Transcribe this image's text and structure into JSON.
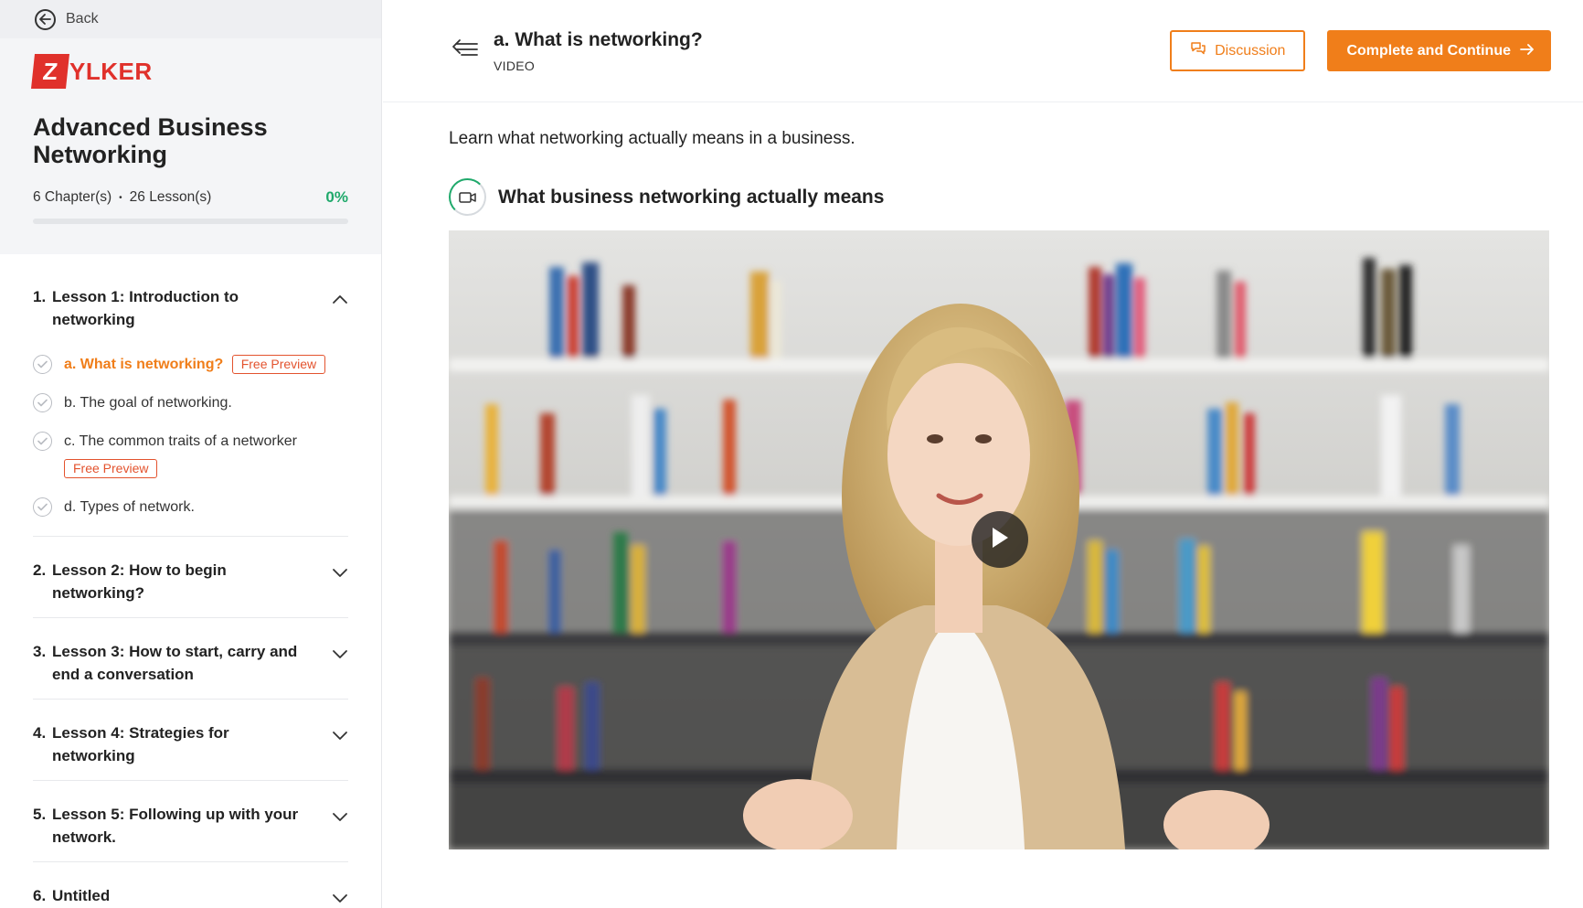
{
  "sidebar": {
    "back_label": "Back",
    "logo": {
      "mark": "Z",
      "text": "YLKER"
    },
    "course_title": "Advanced Business Networking",
    "chapters": "6 Chapter(s)",
    "separator": "•",
    "lessons_count": "26 Lesson(s)",
    "progress_text": "0%",
    "progress_value": 0,
    "lessons": [
      {
        "num": "1.",
        "title": "Lesson 1: Introduction to networking",
        "expanded": true,
        "items": [
          {
            "label": "a. What is networking?",
            "badge": "Free Preview",
            "active": true
          },
          {
            "label": "b. The goal of networking."
          },
          {
            "label": "c. The common traits of a networker",
            "badge": "Free Preview"
          },
          {
            "label": "d. Types of network."
          }
        ]
      },
      {
        "num": "2.",
        "title": "Lesson 2: How to begin networking?"
      },
      {
        "num": "3.",
        "title": "Lesson 3: How to start, carry and end a conversation"
      },
      {
        "num": "4.",
        "title": "Lesson 4: Strategies for networking"
      },
      {
        "num": "5.",
        "title": "Lesson 5: Following up with your network."
      },
      {
        "num": "6.",
        "title": "Untitled"
      }
    ]
  },
  "header": {
    "title": "a. What is networking?",
    "type": "VIDEO",
    "discussion_label": "Discussion",
    "complete_label": "Complete and Continue"
  },
  "content": {
    "description": "Learn what networking actually means in a business.",
    "video_title": "What business networking actually means"
  },
  "icons": {
    "back": "arrow-left-circle-icon",
    "collapse_sidebar": "menu-collapse-icon",
    "discussion": "chat-bubbles-icon",
    "continue": "arrow-right-icon",
    "video": "video-camera-icon",
    "play": "play-icon",
    "expanded": "chevron-up-icon",
    "collapsed": "chevron-down-icon",
    "check": "check-circle-icon"
  },
  "colors": {
    "accent": "#f07e1a",
    "badge": "#e3532e",
    "brand": "#e0312b",
    "success": "#1fa96b"
  }
}
